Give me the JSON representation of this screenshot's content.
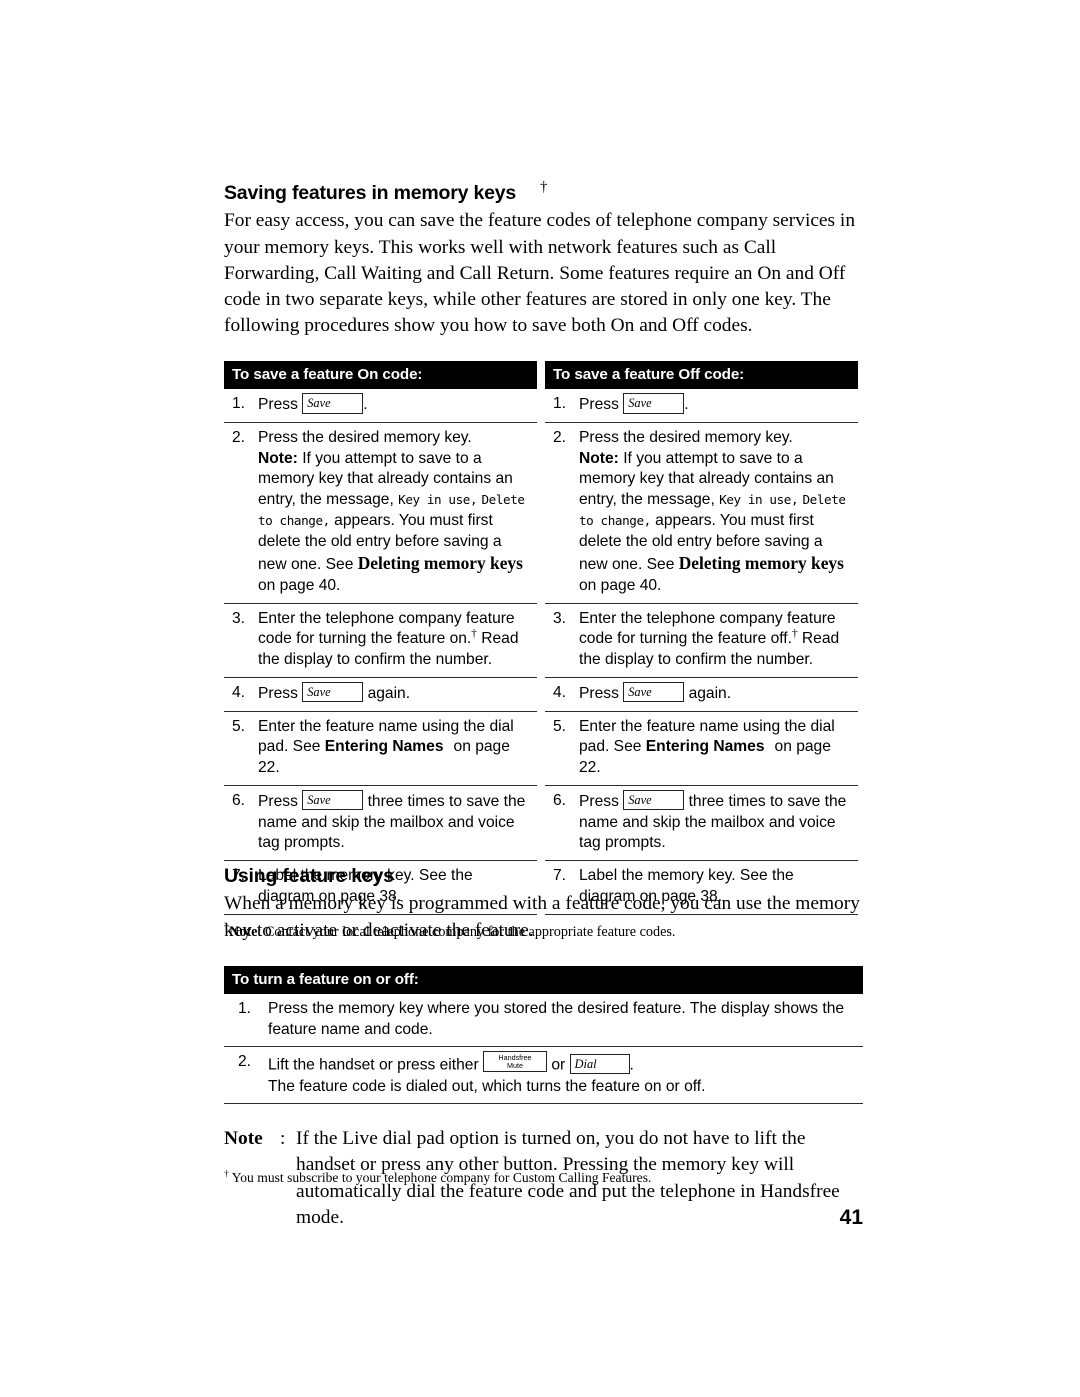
{
  "document": {
    "page_number": "41"
  },
  "section1": {
    "heading": "Saving features in memory keys",
    "heading_dagger": "†",
    "intro": "For easy access, you can save the feature codes of telephone company services in your memory keys. This works well with network features such as Call Forwarding, Call Waiting and Call Return. Some features require an On and Off code in two separate keys, while other features are stored in only one key. The following procedures show you how to save both On and Off codes.",
    "table_footnote_marker": "†",
    "table_footnote_label": "Note",
    "table_footnote_text": ": Contact your local telephone company for the appropriate feature codes."
  },
  "table_on": {
    "header": "To save a feature On code:",
    "rows": [
      {
        "num": "1.",
        "press_label": "Press",
        "key": "Save",
        "trailing": "."
      },
      {
        "num": "2.",
        "line1": "Press the desired memory key.",
        "note_label": "Note:",
        "note_part1": "If you attempt to save to a memory key that already contains an entry, the message,",
        "lcd1": "Key in use,",
        "lcd2": "Delete to change,",
        "note_part2": "appears. You must first delete the old entry before saving a new one.  See",
        "ref_bold": "Deleting memory keys",
        "note_part3": "on page 40."
      },
      {
        "num": "3.",
        "text_before": "Enter the telephone company feature code for turning the feature on.",
        "dagger": "†",
        "text_after": "Read the display to confirm the number."
      },
      {
        "num": "4.",
        "press_label": "Press",
        "key": "Save",
        "trailing": "again."
      },
      {
        "num": "5.",
        "text_before": "Enter the feature name using the dial pad. See",
        "ref_bold": "Entering Names",
        "text_after": "on page 22."
      },
      {
        "num": "6.",
        "press_label": "Press",
        "key": "Save",
        "trailing": "three times to save the name and skip the mailbox and voice tag prompts."
      },
      {
        "num": "7.",
        "text": "Label the memory key. See the diagram on page 38."
      }
    ]
  },
  "table_off": {
    "header": "To save a feature Off code:",
    "rows": [
      {
        "num": "1.",
        "press_label": "Press",
        "key": "Save",
        "trailing": "."
      },
      {
        "num": "2.",
        "line1": "Press the desired memory key.",
        "note_label": "Note:",
        "note_part1": "If you attempt to save to a memory key that already contains an entry, the message,",
        "lcd1": "Key in use,",
        "lcd2": "Delete to change,",
        "note_part2": "appears. You must first delete the old entry before saving a new one.  See",
        "ref_bold": "Deleting memory keys",
        "note_part3": "on page 40."
      },
      {
        "num": "3.",
        "text_before": "Enter the telephone company feature code for turning the feature off.",
        "dagger": "†",
        "text_after": "Read the display to confirm the number."
      },
      {
        "num": "4.",
        "press_label": "Press",
        "key": "Save",
        "trailing": "again."
      },
      {
        "num": "5.",
        "text_before": "Enter the feature name using the dial pad. See",
        "ref_bold": "Entering Names",
        "text_after": "on page 22."
      },
      {
        "num": "6.",
        "press_label": "Press",
        "key": "Save",
        "trailing": "three times to save the name and skip the mailbox and voice tag prompts."
      },
      {
        "num": "7.",
        "text": "Label the memory key. See the diagram on page 38."
      }
    ]
  },
  "section2": {
    "heading": "Using feature keys",
    "intro": "When a memory key is programmed with a feature code, you can use the memory key to activate or deactivate the feature."
  },
  "table_onoff": {
    "header": "To turn a feature on or off:",
    "rows": [
      {
        "num": "1.",
        "text": "Press the memory key where you stored the desired feature. The display shows the feature name and code."
      },
      {
        "num": "2.",
        "text_before": "Lift the handset or press either",
        "key_handsfree_line1": "Handsfree",
        "key_handsfree_line2": "Mute",
        "or_word": "or",
        "key_dial": "Dial",
        "trailing": ".",
        "line2": "The feature code is dialed out, which turns the feature on or off."
      }
    ]
  },
  "bottom_note": {
    "label": "Note",
    "colon": ":",
    "text": "If the Live dial pad option is turned on, you do not have to lift the handset or press any other button. Pressing the memory key will automatically dial the feature code and put the telephone in Handsfree mode."
  },
  "page_footnote": {
    "marker": "†",
    "text": "You must subscribe to your telephone company for Custom Calling Features."
  }
}
